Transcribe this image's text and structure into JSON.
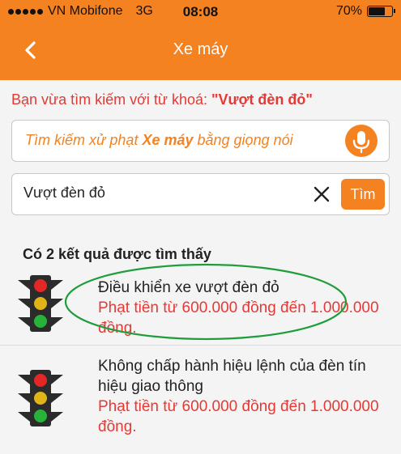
{
  "status_bar": {
    "carrier": "VN Mobifone",
    "network": "3G",
    "time": "08:08",
    "battery_text": "70%",
    "battery_level": 0.7
  },
  "nav": {
    "title": "Xe máy",
    "back_icon": "chevron-left-icon"
  },
  "notice": {
    "prefix": "Bạn vừa tìm kiếm với từ khoá: ",
    "keyword": "\"Vượt đèn đỏ\""
  },
  "voice_search": {
    "text_before": "Tìm kiếm xử phạt ",
    "text_bold": "Xe máy",
    "text_after": " bằng giọng nói",
    "icon": "microphone-icon"
  },
  "query": {
    "value": "Vượt đèn đỏ",
    "clear_icon": "close-icon",
    "search_button": "Tìm"
  },
  "results": {
    "count_label": "Có 2 kết quả được tìm thấy",
    "items": [
      {
        "icon": "traffic-light-icon",
        "title": "Điều khiển xe vượt đèn đỏ",
        "fine": "Phạt tiền từ 600.000 đồng đến 1.000.000 đồng."
      },
      {
        "icon": "traffic-light-icon",
        "title": "Không chấp hành hiệu lệnh của đèn tín hiệu giao thông",
        "fine": "Phạt tiền từ 600.000 đồng đến 1.000.000 đồng."
      }
    ]
  },
  "colors": {
    "primary": "#f58220",
    "alert_red": "#e53935",
    "highlight_green": "#1f9d3a"
  }
}
